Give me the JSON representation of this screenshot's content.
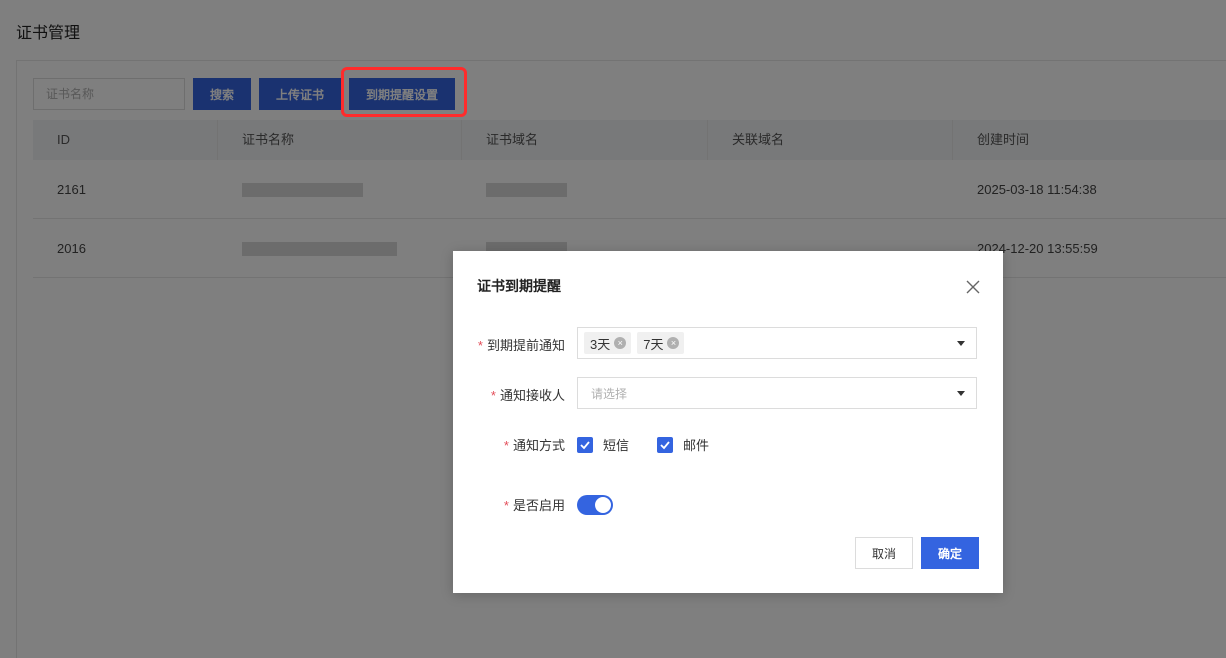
{
  "page": {
    "title": "证书管理"
  },
  "toolbar": {
    "search_placeholder": "证书名称",
    "search_label": "搜索",
    "upload_label": "上传证书",
    "expiry_label": "到期提醒设置"
  },
  "table": {
    "columns": [
      "ID",
      "证书名称",
      "证书域名",
      "关联域名",
      "创建时间"
    ],
    "rows": [
      {
        "id": "2161",
        "created": "2025-03-18 11:54:38"
      },
      {
        "id": "2016",
        "created": "2024-12-20 13:55:59"
      }
    ]
  },
  "dialog": {
    "title": "证书到期提醒",
    "advance_label": "到期提前通知",
    "advance_tags": [
      "3天",
      "7天"
    ],
    "recipient_label": "通知接收人",
    "recipient_placeholder": "请选择",
    "method_label": "通知方式",
    "method_sms": "短信",
    "method_email": "邮件",
    "method_sms_checked": true,
    "method_email_checked": true,
    "enabled_label": "是否启用",
    "enabled": true,
    "cancel_label": "取消",
    "ok_label": "确定"
  },
  "colors": {
    "primary": "#3464e0",
    "highlight": "#ff2b2b",
    "required": "#e34d59"
  },
  "icons": {
    "close": "close-icon",
    "caret": "chevron-down-icon",
    "check": "check-icon",
    "tag_remove": "tag-remove-icon"
  }
}
